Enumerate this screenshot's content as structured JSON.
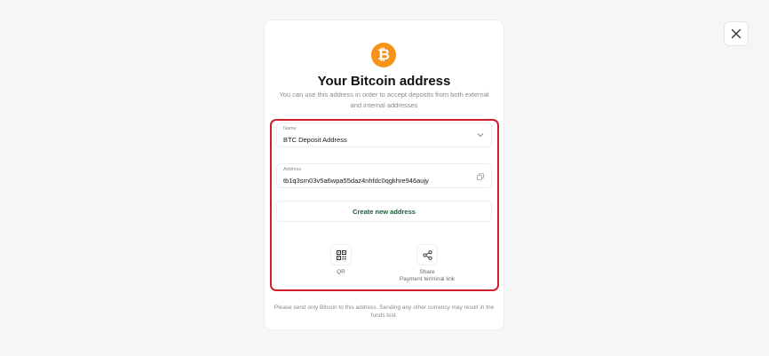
{
  "modal": {
    "logo_symbol": "₿",
    "title": "Your Bitcoin address",
    "subtitle": "You can use this address in order to accept deposits from both external and internal addresses",
    "name_field": {
      "label": "Name",
      "value": "BTC Deposit Address"
    },
    "address_field": {
      "label": "Address",
      "value": "tb1q3srn03v5a6wpa55daz4nhfdc0qgkhre946aujy"
    },
    "create_button_label": "Create new address",
    "actions": [
      {
        "label": "QR",
        "icon": "qr-code-icon"
      },
      {
        "label": "Share",
        "sublabel": "Payment terminal link",
        "icon": "share-icon"
      }
    ],
    "footer_note": "Please send only Bitcoin to this address. Sending any other currency may result in the funds lost."
  },
  "colors": {
    "brand_bitcoin": "#f7931a",
    "highlight_border": "#d0202e",
    "button_text": "#1c5a3a"
  }
}
